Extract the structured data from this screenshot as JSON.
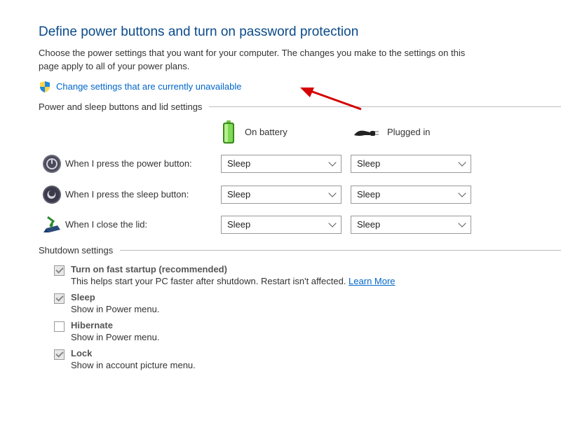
{
  "page_title": "Define power buttons and turn on password protection",
  "subtitle": "Choose the power settings that you want for your computer. The changes you make to the settings on this page apply to all of your power plans.",
  "change_link": "Change settings that are currently unavailable",
  "section_power_lid": "Power and sleep buttons and lid settings",
  "columns": {
    "battery": "On battery",
    "plugged": "Plugged in"
  },
  "rows": {
    "power_button": {
      "label": "When I press the power button:",
      "battery": "Sleep",
      "plugged": "Sleep"
    },
    "sleep_button": {
      "label": "When I press the sleep button:",
      "battery": "Sleep",
      "plugged": "Sleep"
    },
    "lid": {
      "label": "When I close the lid:",
      "battery": "Sleep",
      "plugged": "Sleep"
    }
  },
  "section_shutdown": "Shutdown settings",
  "shutdown": {
    "fast_startup": {
      "label": "Turn on fast startup (recommended)",
      "desc": "This helps start your PC faster after shutdown. Restart isn't affected.",
      "learn": "Learn More",
      "checked": true
    },
    "sleep": {
      "label": "Sleep",
      "desc": "Show in Power menu.",
      "checked": true
    },
    "hibernate": {
      "label": "Hibernate",
      "desc": "Show in Power menu.",
      "checked": false
    },
    "lock": {
      "label": "Lock",
      "desc": "Show in account picture menu.",
      "checked": true
    }
  }
}
